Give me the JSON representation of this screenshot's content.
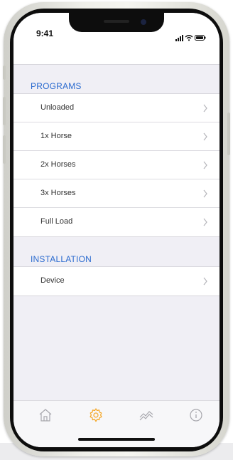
{
  "status_bar": {
    "time": "9:41"
  },
  "sections": [
    {
      "label": "PROGRAMS",
      "items": [
        {
          "label": "Unloaded"
        },
        {
          "label": "1x Horse"
        },
        {
          "label": "2x Horses"
        },
        {
          "label": "3x Horses"
        },
        {
          "label": "Full Load"
        }
      ]
    },
    {
      "label": "INSTALLATION",
      "items": [
        {
          "label": "Device"
        }
      ]
    }
  ],
  "tab_bar": {
    "active_tab": "settings",
    "tabs": [
      {
        "icon": "home-icon"
      },
      {
        "icon": "gear-icon"
      },
      {
        "icon": "activity-icon"
      },
      {
        "icon": "info-icon"
      }
    ]
  },
  "colors": {
    "accent": "#2a6acf",
    "active_tab": "#f5a623",
    "inactive_tab": "#a7a7ad",
    "background": "#f0eff5"
  }
}
